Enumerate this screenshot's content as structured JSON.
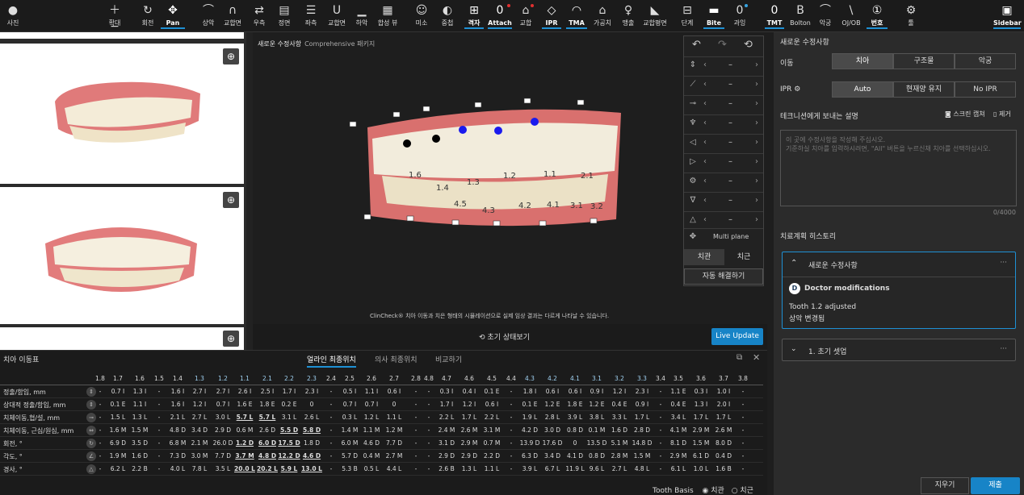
{
  "toolbar": {
    "items": [
      {
        "label": "사진",
        "icon": "person-icon"
      },
      {
        "label": "확대",
        "icon": "plus-minus-icon"
      },
      {
        "label": "회전",
        "icon": "rotate-icon"
      },
      {
        "label": "Pan",
        "icon": "pan-icon"
      },
      {
        "label": "상악",
        "icon": "upper-jaw-icon"
      },
      {
        "label": "교합면",
        "icon": "occlusal-icon"
      },
      {
        "label": "우측",
        "icon": "right-view-icon"
      },
      {
        "label": "정면",
        "icon": "front-view-icon"
      },
      {
        "label": "좌측",
        "icon": "left-view-icon"
      },
      {
        "label": "교합면",
        "icon": "occlusal-lower-icon"
      },
      {
        "label": "하악",
        "icon": "lower-jaw-icon"
      },
      {
        "label": "합성 뷰",
        "icon": "composite-view-icon"
      },
      {
        "label": "미소",
        "icon": "smile-icon"
      },
      {
        "label": "중첩",
        "icon": "overlay-icon"
      },
      {
        "label": "격자",
        "icon": "grid-icon"
      },
      {
        "label": "Attach",
        "icon": "attachment-icon"
      },
      {
        "label": "교합",
        "icon": "occlusion-icon"
      },
      {
        "label": "IPR",
        "icon": "ipr-icon"
      },
      {
        "label": "TMA",
        "icon": "tma-icon"
      },
      {
        "label": "가공치",
        "icon": "pontic-icon"
      },
      {
        "label": "맹출",
        "icon": "eruption-icon"
      },
      {
        "label": "교합평면",
        "icon": "occlusal-plane-icon"
      },
      {
        "label": "단계",
        "icon": "stages-icon"
      },
      {
        "label": "Bite",
        "icon": "bite-icon"
      },
      {
        "label": "과잉",
        "icon": "excess-icon"
      },
      {
        "label": "TMT",
        "icon": "tmt-icon"
      },
      {
        "label": "Bolton",
        "icon": "bolton-icon"
      },
      {
        "label": "악궁",
        "icon": "arch-icon"
      },
      {
        "label": "OJ/OB",
        "icon": "overjet-icon"
      },
      {
        "label": "번호",
        "icon": "numbering-icon"
      },
      {
        "label": "툴",
        "icon": "gear-icon"
      },
      {
        "label": "Sidebar",
        "icon": "sidebar-icon"
      }
    ]
  },
  "viewer": {
    "title": "새로운 수정사항",
    "subtitle": "Comprehensive 패키지",
    "tooth_labels": [
      "1.6",
      "1.4",
      "1.3",
      "1.2",
      "1.1",
      "2.1",
      "4.5",
      "4.3",
      "4.2",
      "4.1",
      "3.1",
      "3.2"
    ],
    "disclaimer": "ClinCheck® 치아 이동과 치은 형태의 시뮬레이션으로 실제 임상 결과는 다르게 나타날 수 있습니다.",
    "controls": {
      "rows": [
        {
          "icon": "mesial-distal-icon",
          "value": "–"
        },
        {
          "icon": "angulation-icon",
          "value": "–"
        },
        {
          "icon": "buccal-lingual-icon",
          "value": "–"
        },
        {
          "icon": "intrusion-icon",
          "value": "–"
        },
        {
          "icon": "rotation-icon",
          "value": "–"
        },
        {
          "icon": "inclination-icon",
          "value": "–"
        },
        {
          "icon": "torque-icon",
          "value": "–"
        },
        {
          "icon": "tip-icon",
          "value": "–"
        },
        {
          "icon": "tilt-icon",
          "value": "–"
        }
      ],
      "multi_plane": "Multi plane",
      "crown": "치관",
      "root": "치근",
      "auto_resolve": "자동 해결하기"
    },
    "reset_view": "초기 상태보기",
    "live_update": "Live Update"
  },
  "movement_table": {
    "title": "치아 이동표",
    "tabs": [
      "얼라인 최종위치",
      "의사 최종위치",
      "비교하기"
    ],
    "teeth": [
      "1.8",
      "1.7",
      "1.6",
      "1.5",
      "1.4",
      "1.3",
      "1.2",
      "1.1",
      "2.1",
      "2.2",
      "2.3",
      "2.4",
      "2.5",
      "2.6",
      "2.7",
      "2.8",
      "4.8",
      "4.7",
      "4.6",
      "4.5",
      "4.4",
      "4.3",
      "4.2",
      "4.1",
      "3.1",
      "3.2",
      "3.3",
      "3.4",
      "3.5",
      "3.6",
      "3.7",
      "3.8"
    ],
    "rows": [
      {
        "label": "정출/함입, mm",
        "values": [
          "-",
          "0.7 I",
          "1.3 I",
          "-",
          "1.6 I",
          "2.7 I",
          "2.7 I",
          "2.6 I",
          "2.5 I",
          "1.7 I",
          "2.3 I",
          "-",
          "0.5 I",
          "1.1 I",
          "0.6 I",
          "-",
          "-",
          "0.3 I",
          "0.4 I",
          "0.1 E",
          "-",
          "1.8 I",
          "0.6 I",
          "0.6 I",
          "0.9 I",
          "1.2 I",
          "2.3 I",
          "-",
          "1.1 E",
          "0.3 I",
          "1.0 I",
          "-"
        ]
      },
      {
        "label": "상대적 정출/함입, mm",
        "values": [
          "-",
          "0.1 E",
          "1.1 I",
          "-",
          "1.6 I",
          "1.2 I",
          "0.7 I",
          "1.6 E",
          "1.8 E",
          "0.2 E",
          "0",
          "-",
          "0.7 I",
          "0.7 I",
          "0",
          "-",
          "-",
          "1.7 I",
          "1.2 I",
          "0.6 I",
          "-",
          "0.1 E",
          "1.2 E",
          "1.8 E",
          "1.2 E",
          "0.4 E",
          "0.9 I",
          "-",
          "0.4 E",
          "1.3 I",
          "2.0 I",
          "-"
        ]
      },
      {
        "label": "치체이동,협/설, mm",
        "values": [
          "-",
          "1.5 L",
          "1.3 L",
          "-",
          "2.1 L",
          "2.7 L",
          "3.0 L",
          "5.7 L",
          "5.7 L",
          "3.1 L",
          "2.6 L",
          "-",
          "0.3 L",
          "1.2 L",
          "1.1 L",
          "-",
          "-",
          "2.2 L",
          "1.7 L",
          "2.2 L",
          "-",
          "1.9 L",
          "2.8 L",
          "3.9 L",
          "3.8 L",
          "3.3 L",
          "1.7 L",
          "-",
          "3.4 L",
          "1.7 L",
          "1.7 L",
          "-"
        ]
      },
      {
        "label": "치체이동, 근심/원심, mm",
        "values": [
          "-",
          "1.6 M",
          "1.5 M",
          "-",
          "4.8 D",
          "3.4 D",
          "2.9 D",
          "0.6 M",
          "2.6 D",
          "5.5 D",
          "5.8 D",
          "-",
          "1.4 M",
          "1.1 M",
          "1.2 M",
          "-",
          "-",
          "2.4 M",
          "2.6 M",
          "3.1 M",
          "-",
          "4.2 D",
          "3.0 D",
          "0.8 D",
          "0.1 M",
          "1.6 D",
          "2.8 D",
          "-",
          "4.1 M",
          "2.9 M",
          "2.6 M",
          "-"
        ]
      },
      {
        "label": "회전, °",
        "values": [
          "-",
          "6.9 D",
          "3.5 D",
          "-",
          "6.8 M",
          "2.1 M",
          "26.0 D",
          "1.2 D",
          "6.0 D",
          "17.5 D",
          "1.8 D",
          "-",
          "6.0 M",
          "4.6 D",
          "7.7 D",
          "-",
          "-",
          "3.1 D",
          "2.9 M",
          "0.7 M",
          "-",
          "13.9 D",
          "17.6 D",
          "0",
          "13.5 D",
          "5.1 M",
          "14.8 D",
          "-",
          "8.1 D",
          "1.5 M",
          "8.0 D",
          "-"
        ]
      },
      {
        "label": "각도, °",
        "values": [
          "-",
          "1.9 M",
          "1.6 D",
          "-",
          "7.3 D",
          "3.0 M",
          "7.7 D",
          "3.7 M",
          "4.8 D",
          "12.2 D",
          "4.6 D",
          "-",
          "5.7 D",
          "0.4 M",
          "2.7 M",
          "-",
          "-",
          "2.9 D",
          "2.9 D",
          "2.2 D",
          "-",
          "6.3 D",
          "3.4 D",
          "4.1 D",
          "0.8 D",
          "2.8 M",
          "1.5 M",
          "-",
          "2.9 M",
          "6.1 D",
          "0.4 D",
          "-"
        ]
      },
      {
        "label": "경사, °",
        "values": [
          "-",
          "6.2 L",
          "2.2 B",
          "-",
          "4.0 L",
          "7.8 L",
          "3.5 L",
          "20.0 L",
          "20.2 L",
          "5.9 L",
          "13.0 L",
          "-",
          "5.3 B",
          "0.5 L",
          "4.4 L",
          "-",
          "-",
          "2.6 B",
          "1.3 L",
          "1.1 L",
          "-",
          "3.9 L",
          "6.7 L",
          "11.9 L",
          "9.6 L",
          "2.7 L",
          "4.8 L",
          "-",
          "6.1 L",
          "1.0 L",
          "1.6 B",
          "-"
        ]
      }
    ],
    "row_icons": [
      "extrusion-icon",
      "relative-extrusion-icon",
      "bucco-lingual-icon",
      "mesio-distal-icon",
      "rotation-icon",
      "angulation-icon",
      "inclination-icon"
    ],
    "tooth_basis": "Tooth Basis",
    "basis_crown": "치관",
    "basis_root": "치근"
  },
  "sidebar": {
    "title": "새로운 수정사항",
    "move_label": "이동",
    "move_options": [
      "치아",
      "구조물",
      "악궁"
    ],
    "ipr_label": "IPR",
    "ipr_options": [
      "Auto",
      "현재양 유지",
      "No IPR"
    ],
    "tech_note_label": "테크니션에게 보내는 설명",
    "screen_capture": "스크린 캡쳐",
    "remove": "제거",
    "note_placeholder": "이 곳에 수정사항을 작성해 주십시오.\n기준하실 치아를 입력하시려면, \"All\" 버튼을 누르신채 치아를 선택하십시오.",
    "char_count": "0/4000",
    "history_label": "치료계획 히스토리",
    "history_card_title": "새로운 수정사항",
    "doctor_badge": "D",
    "doctor_mod": "Doctor modifications",
    "mod_line1": "Tooth 1.2 adjusted",
    "mod_line2": "상악 변경됨",
    "setup_card": "1. 초기 셋업",
    "more": "···",
    "cancel": "지우기",
    "submit": "제출"
  },
  "colors": {
    "accent": "#1784c7",
    "point_black": "#000000",
    "point_blue": "#1a1aee"
  }
}
